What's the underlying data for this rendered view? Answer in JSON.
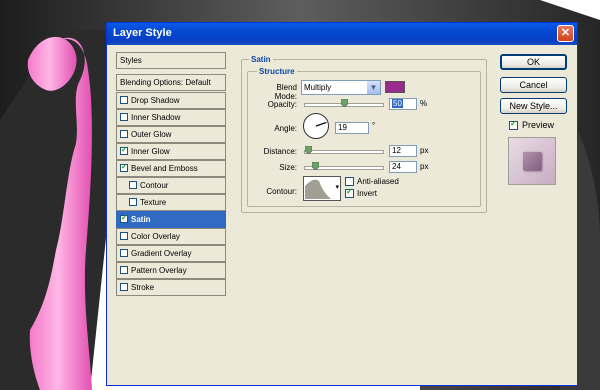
{
  "window": {
    "title": "Layer Style",
    "close_glyph": "✕"
  },
  "styles_list": {
    "header": "Styles",
    "blending": "Blending Options: Default",
    "items": [
      {
        "label": "Drop Shadow",
        "checked": false,
        "indent": false
      },
      {
        "label": "Inner Shadow",
        "checked": false,
        "indent": false
      },
      {
        "label": "Outer Glow",
        "checked": false,
        "indent": false
      },
      {
        "label": "Inner Glow",
        "checked": true,
        "indent": false
      },
      {
        "label": "Bevel and Emboss",
        "checked": true,
        "indent": false
      },
      {
        "label": "Contour",
        "checked": false,
        "indent": true
      },
      {
        "label": "Texture",
        "checked": false,
        "indent": true
      },
      {
        "label": "Satin",
        "checked": true,
        "indent": false,
        "selected": true
      },
      {
        "label": "Color Overlay",
        "checked": false,
        "indent": false
      },
      {
        "label": "Gradient Overlay",
        "checked": false,
        "indent": false
      },
      {
        "label": "Pattern Overlay",
        "checked": false,
        "indent": false
      },
      {
        "label": "Stroke",
        "checked": false,
        "indent": false
      }
    ]
  },
  "satin": {
    "group_title": "Satin",
    "structure_title": "Structure",
    "blend_mode_label": "Blend Mode:",
    "blend_mode_value": "Multiply",
    "blend_color": "#9b2a8e",
    "opacity_label": "Opacity:",
    "opacity_value": "50",
    "opacity_unit": "%",
    "opacity_level": 0.5,
    "angle_label": "Angle:",
    "angle_value": "19",
    "angle_unit": "°",
    "distance_label": "Distance:",
    "distance_value": "12",
    "distance_unit": "px",
    "size_label": "Size:",
    "size_value": "24",
    "size_unit": "px",
    "contour_label": "Contour:",
    "anti_aliased_label": "Anti-aliased",
    "anti_aliased": false,
    "invert_label": "Invert",
    "invert": true
  },
  "buttons": {
    "ok": "OK",
    "cancel": "Cancel",
    "new_style": "New Style..."
  },
  "preview": {
    "label": "Preview",
    "checked": true
  }
}
